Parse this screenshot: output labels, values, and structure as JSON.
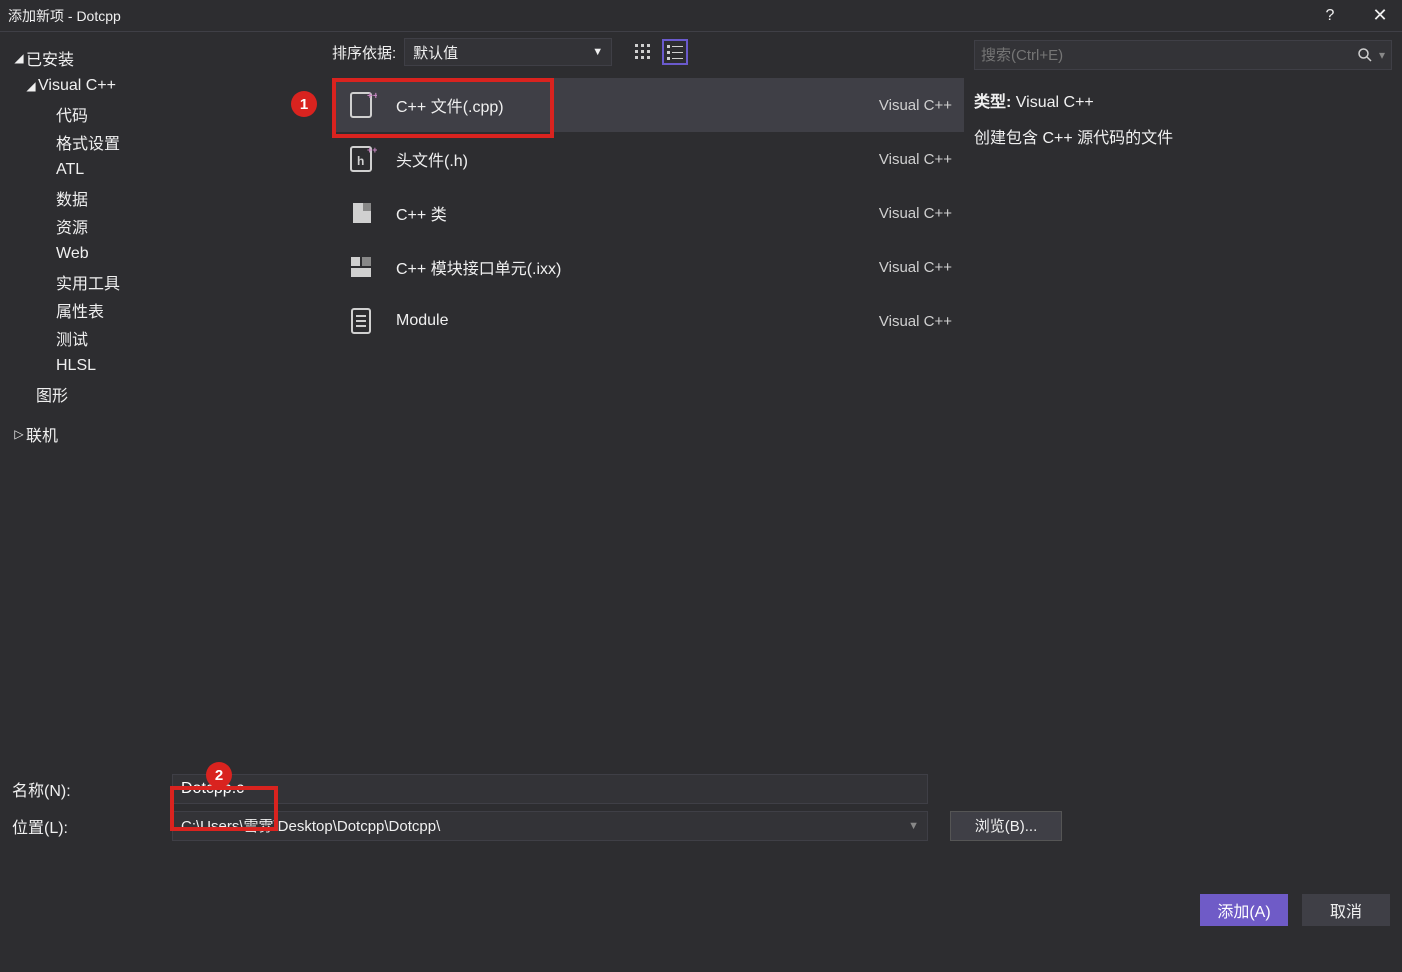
{
  "window": {
    "title": "添加新项 - Dotcpp",
    "help": "?",
    "close": "✕"
  },
  "sidebar": {
    "installed": "已安装",
    "vcpp": "Visual C++",
    "items": [
      "代码",
      "格式设置",
      "ATL",
      "数据",
      "资源",
      "Web",
      "实用工具",
      "属性表",
      "测试",
      "HLSL"
    ],
    "graphics": "图形",
    "online": "联机"
  },
  "sort": {
    "label": "排序依据:",
    "value": "默认值"
  },
  "templates": [
    {
      "name": "C++ 文件(.cpp)",
      "lang": "Visual C++"
    },
    {
      "name": "头文件(.h)",
      "lang": "Visual C++"
    },
    {
      "name": "C++ 类",
      "lang": "Visual C++"
    },
    {
      "name": "C++ 模块接口单元(.ixx)",
      "lang": "Visual C++"
    },
    {
      "name": "Module",
      "lang": "Visual C++"
    }
  ],
  "search": {
    "placeholder": "搜索(Ctrl+E)"
  },
  "info": {
    "type_label": "类型:",
    "type_value": "Visual C++",
    "desc": "创建包含 C++ 源代码的文件"
  },
  "markers": {
    "m1": "1",
    "m2": "2"
  },
  "fields": {
    "name_label": "名称(N):",
    "name_value": "Dotcpp.c",
    "loc_label": "位置(L):",
    "loc_value": "C:\\Users\\雪雰\\Desktop\\Dotcpp\\Dotcpp\\",
    "browse": "浏览(B)..."
  },
  "footer": {
    "add": "添加(A)",
    "cancel": "取消"
  }
}
